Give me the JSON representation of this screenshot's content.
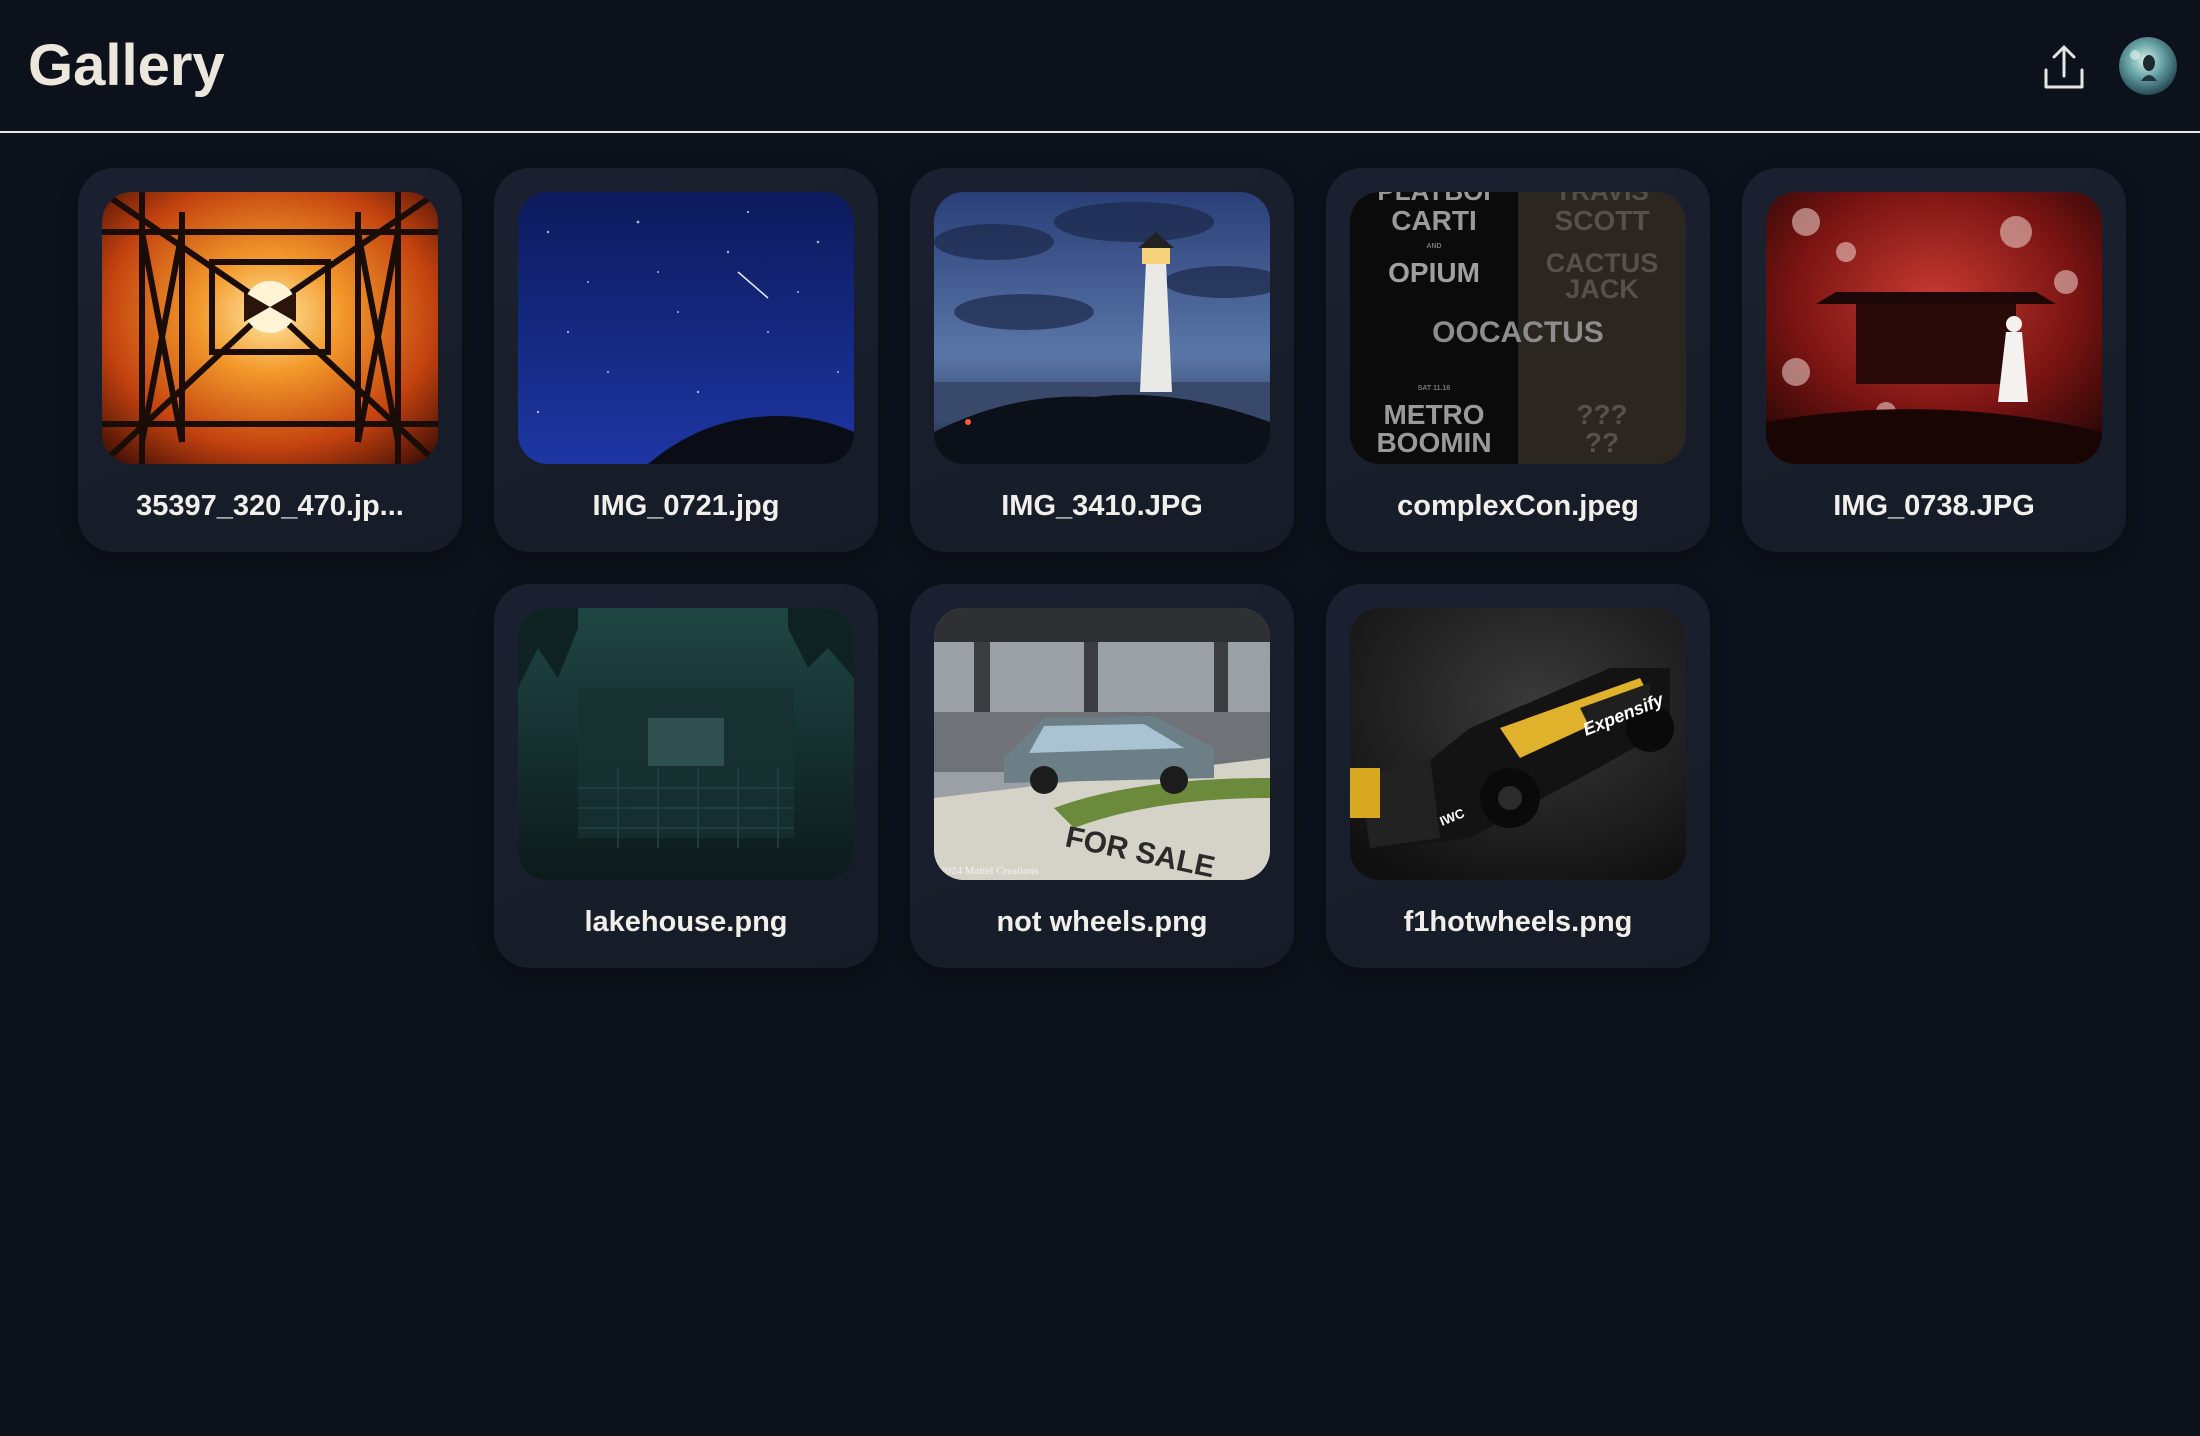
{
  "header": {
    "title": "Gallery",
    "upload_icon": "upload-icon",
    "avatar_icon": "profile-avatar"
  },
  "theme": {
    "background": "#0d111b",
    "card": "#1b2130",
    "title_color": "#ece7dd",
    "divider": "#e8e8e8"
  },
  "gallery": {
    "items": [
      {
        "filename": "35397_320_470.jp...",
        "thumbnail": "fiery-tower-structure"
      },
      {
        "filename": "IMG_0721.jpg",
        "thumbnail": "starry-night-sky"
      },
      {
        "filename": "IMG_3410.JPG",
        "thumbnail": "lighthouse-at-dusk"
      },
      {
        "filename": "complexCon.jpeg",
        "thumbnail": "concert-poster",
        "poster_text": {
          "left_top": "PLAYBOI",
          "left_2": "CARTI",
          "left_and": "AND",
          "left_3": "OPIUM",
          "right_top": "TRAVIS",
          "right_2": "SCOTT",
          "right_3": "CACTUS",
          "right_4": "JACK",
          "center": "OOCACTUS",
          "left_date": "SAT 11.16",
          "left_5": "METRO",
          "left_6": "BOOMIN",
          "right_5": "???",
          "right_6": "??"
        }
      },
      {
        "filename": "IMG_0738.JPG",
        "thumbnail": "red-shrine-artwork"
      },
      {
        "filename": "lakehouse.png",
        "thumbnail": "dark-green-lakehouse"
      },
      {
        "filename": "not wheels.png",
        "thumbnail": "parked-car-for-sale",
        "sign_text": "FOR SALE",
        "watermark": "2024 Mattel Creations"
      },
      {
        "filename": "f1hotwheels.png",
        "thumbnail": "formula-one-car",
        "livery_text": "Expensify",
        "wing_text": "IWC"
      }
    ]
  }
}
